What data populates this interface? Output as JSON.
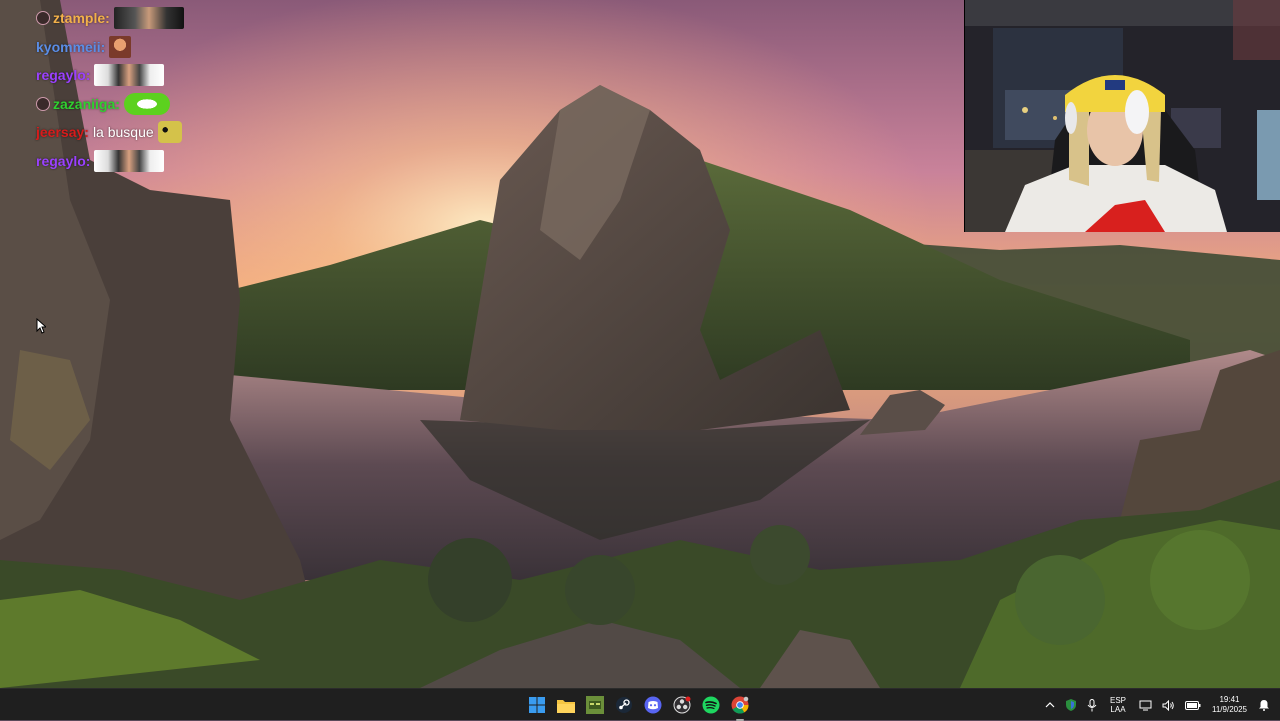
{
  "chat": {
    "messages": [
      {
        "user": "ztample:",
        "color": "#f3b14a",
        "badge": true,
        "text": "",
        "emote": "wide"
      },
      {
        "user": "kyommeii:",
        "color": "#5a8de6",
        "badge": false,
        "text": "",
        "emote": "sq"
      },
      {
        "user": "regaylo:",
        "color": "#9a40ff",
        "badge": false,
        "text": "",
        "emote": "white"
      },
      {
        "user": "zazaniiga:",
        "color": "#2fd02f",
        "badge": true,
        "text": "",
        "emote": "green"
      },
      {
        "user": "jeersay:",
        "color": "#d81b1b",
        "badge": false,
        "text": "la busque",
        "emote": "frog"
      },
      {
        "user": "regaylo:",
        "color": "#9a40ff",
        "badge": false,
        "text": "",
        "emote": "white"
      }
    ]
  },
  "taskbar": {
    "apps": [
      {
        "name": "start-icon"
      },
      {
        "name": "file-explorer-icon"
      },
      {
        "name": "minecraft-icon"
      },
      {
        "name": "steam-icon"
      },
      {
        "name": "discord-icon"
      },
      {
        "name": "obs-icon"
      },
      {
        "name": "spotify-icon"
      },
      {
        "name": "chrome-icon"
      }
    ],
    "language_line1": "ESP",
    "language_line2": "LAA",
    "time": "19:41",
    "date": "11/9/2025"
  },
  "colors": {
    "taskbar_bg": "#1f1f1f",
    "spotify": "#1ed760",
    "discord": "#5865f2",
    "windows_blue": "#0078d4"
  }
}
